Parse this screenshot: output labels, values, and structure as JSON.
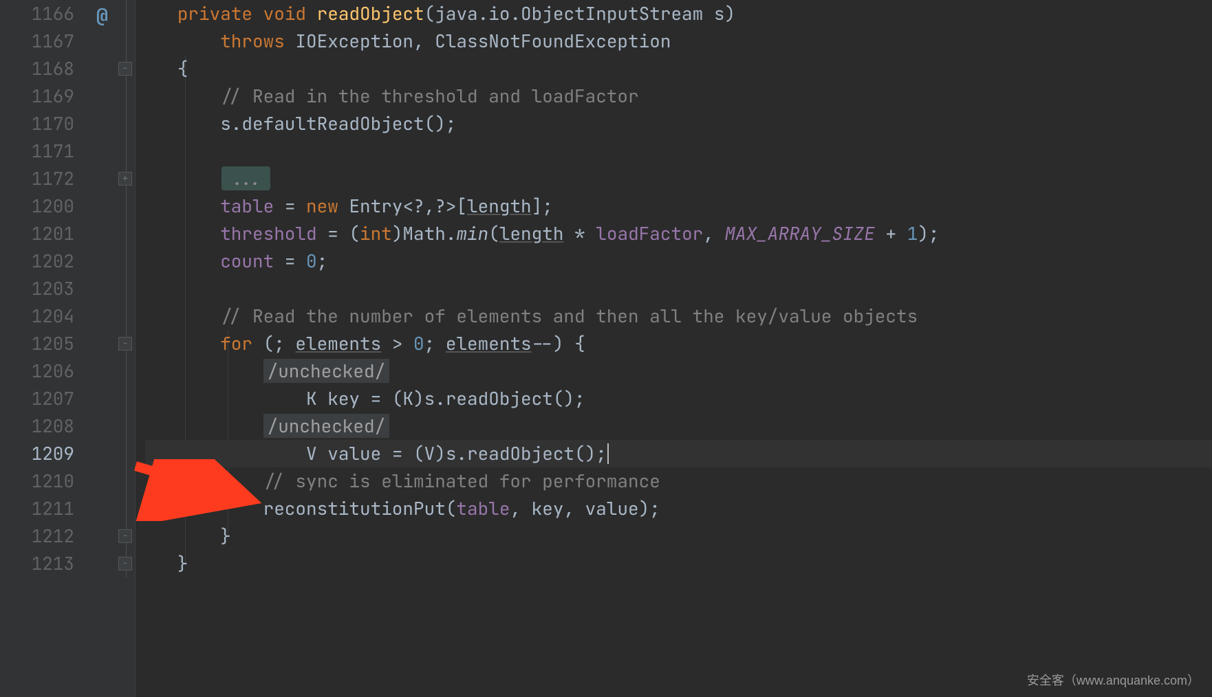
{
  "gutter": {
    "lines": [
      "1166",
      "1167",
      "1168",
      "1169",
      "1170",
      "1171",
      "1172",
      "1200",
      "1201",
      "1202",
      "1203",
      "1204",
      "1205",
      "1206",
      "1207",
      "1208",
      "1209",
      "1210",
      "1211",
      "1212",
      "1213"
    ],
    "current": "1209",
    "change_mark": "@"
  },
  "fold": {
    "collapsed_placeholder": "..."
  },
  "code": {
    "l1166": {
      "kw1": "private",
      "kw2": "void",
      "method": "readObject",
      "p1": "(java.io.ObjectInputStream s)"
    },
    "l1167": {
      "kw": "throws",
      "ex": "IOException, ClassNotFoundException"
    },
    "l1168": {
      "brace": "{"
    },
    "l1169": {
      "comment": "// Read in the threshold and loadFactor"
    },
    "l1170": {
      "stmt_a": "s.defaultReadObject();"
    },
    "l1171": {
      "blank": ""
    },
    "l1172": {
      "fold": "..."
    },
    "l1200": {
      "a": "table",
      "b": " = ",
      "kw": "new",
      "c": " Entry<?,?>[",
      "len": "length",
      "d": "];"
    },
    "l1201": {
      "a": "threshold",
      "b": " = (",
      "kw": "int",
      "c": ")Math.",
      "mname": "min",
      "d": "(",
      "len": "length",
      "e": " * ",
      "f": "loadFactor",
      "g": ", ",
      "const": "MAX_ARRAY_SIZE",
      "h": " + ",
      "num": "1",
      "i": ");"
    },
    "l1202": {
      "a": "count",
      "b": " = ",
      "num": "0",
      "c": ";"
    },
    "l1203": {
      "blank": ""
    },
    "l1204": {
      "comment": "// Read the number of elements and then all the key/value objects"
    },
    "l1205": {
      "kw": "for",
      "a": " (; ",
      "el1": "elements",
      "b": " > ",
      "num": "0",
      "c": "; ",
      "el2": "elements",
      "d": "--) {"
    },
    "l1206": {
      "suppress": "/unchecked/"
    },
    "l1207": {
      "a": "K key = (K)s.readObject();"
    },
    "l1208": {
      "suppress": "/unchecked/"
    },
    "l1209": {
      "a": "V value = (V)s.readObject();"
    },
    "l1210": {
      "comment": "// sync is eliminated for performance"
    },
    "l1211": {
      "m": "reconstitutionPut(",
      "f": "table",
      "b": ", key, value);"
    },
    "l1212": {
      "brace": "}"
    },
    "l1213": {
      "brace": "}"
    }
  },
  "watermark": "安全客（www.anquanke.com）",
  "colors": {
    "keyword": "#cc7832",
    "method": "#ffc66d",
    "comment": "#808080",
    "field": "#9876aa",
    "number": "#6897bb",
    "text": "#a9b7c6",
    "bg": "#2b2b2b",
    "gutter_bg": "#313335",
    "arrow": "#ff3b1f"
  }
}
